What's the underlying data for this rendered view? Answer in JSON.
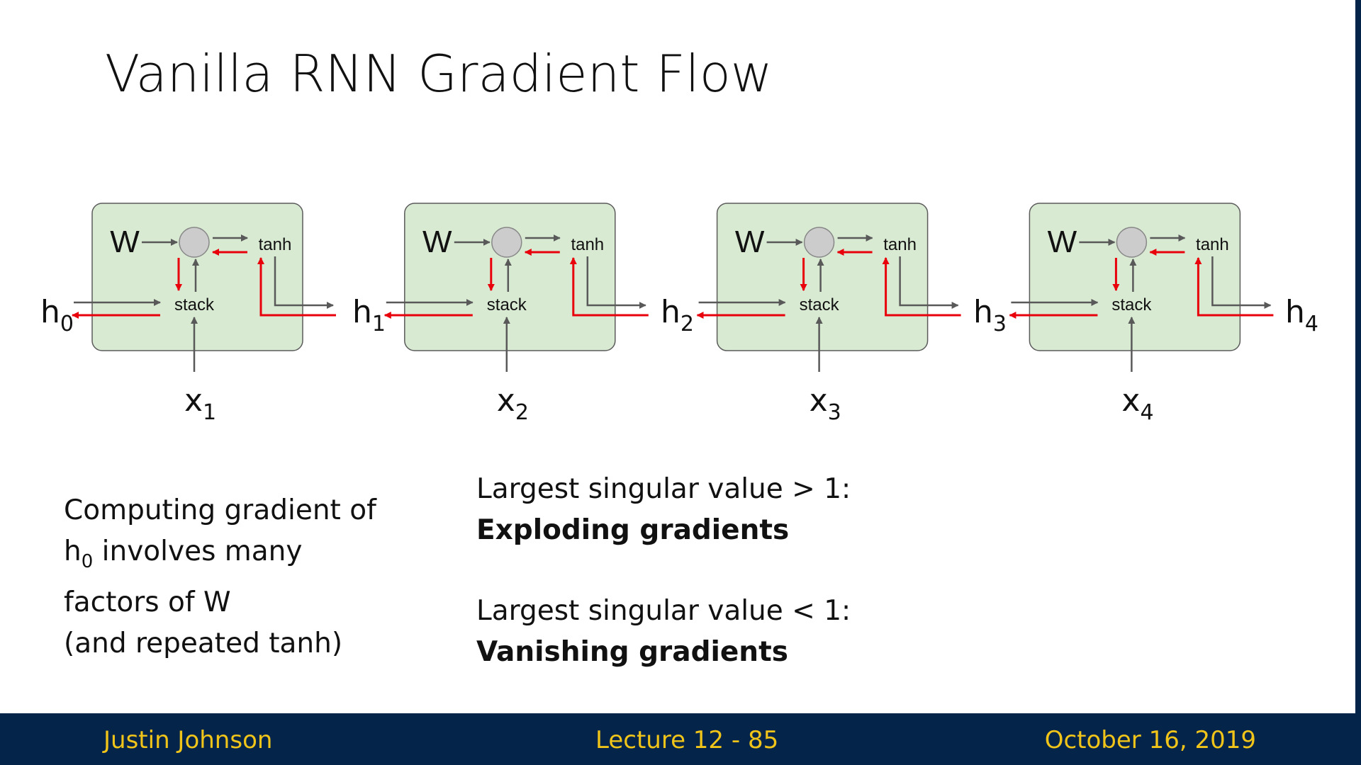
{
  "title": "Vanilla RNN Gradient Flow",
  "diagram": {
    "weight_label": "W",
    "stack_label": "stack",
    "tanh_label": "tanh",
    "hidden_states": [
      {
        "base": "h",
        "sub": "0"
      },
      {
        "base": "h",
        "sub": "1"
      },
      {
        "base": "h",
        "sub": "2"
      },
      {
        "base": "h",
        "sub": "3"
      },
      {
        "base": "h",
        "sub": "4"
      }
    ],
    "inputs": [
      {
        "base": "x",
        "sub": "1"
      },
      {
        "base": "x",
        "sub": "2"
      },
      {
        "base": "x",
        "sub": "3"
      },
      {
        "base": "x",
        "sub": "4"
      }
    ],
    "colors": {
      "cell_fill": "#d9ead3",
      "cell_stroke": "#5b5b5b",
      "forward_arrow": "#595959",
      "backward_arrow": "#e8000b",
      "node_fill": "#cccccc"
    }
  },
  "left_note": {
    "line1": "Computing gradient of",
    "line2_base": "h",
    "line2_sub": "0",
    "line2_rest": " involves many",
    "line3": "factors of W",
    "line4": "(and repeated tanh)"
  },
  "right_note": {
    "case1_condition": "Largest singular value > 1:",
    "case1_result": "Exploding gradients",
    "case2_condition": "Largest singular value < 1:",
    "case2_result": "Vanishing gradients"
  },
  "footer": {
    "author": "Justin Johnson",
    "lecture": "Lecture 12 - 85",
    "date": "October 16, 2019"
  }
}
